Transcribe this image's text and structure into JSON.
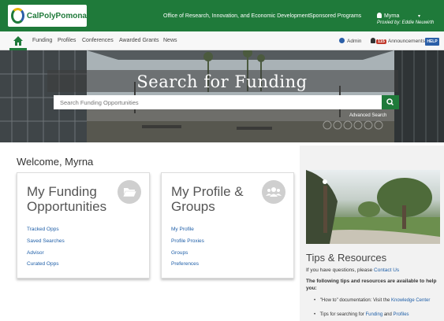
{
  "header": {
    "logo_text": "CalPolyPomona",
    "office_link": "Office of Research, Innovation, and Economic Development",
    "sponsored_link": "Sponsored Programs",
    "user_name": "Myrna",
    "proxied_by": "Proxied by: Eddie Neuwirth"
  },
  "nav": {
    "items": [
      "Funding",
      "Profiles",
      "Conferences",
      "Awarded Grants",
      "News"
    ],
    "admin": "Admin",
    "announcements_count": "115",
    "announcements": "Announcements",
    "help": "HELP"
  },
  "hero": {
    "title": "Search for Funding",
    "search_placeholder": "Search Funding Opportunities",
    "advanced_search": "Advanced Search"
  },
  "welcome": "Welcome, Myrna",
  "cards": [
    {
      "title": "My Funding Opportunities",
      "icon": "folder-open-icon",
      "links": [
        "Tracked Opps",
        "Saved Searches",
        "Advisor",
        "Curated Opps"
      ]
    },
    {
      "title": "My Profile & Groups",
      "icon": "users-icon",
      "links": [
        "My Profile",
        "Profile Proxies",
        "Groups",
        "Preferences"
      ]
    }
  ],
  "tips": {
    "title": "Tips & Resources",
    "questions_prefix": "If you have questions, please ",
    "contact_link": "Contact Us",
    "intro": "The following tips and resources are available to help you:",
    "bullet1_prefix": "\"How to\" documentation: Visit the ",
    "bullet1_link": "Knowledge Center",
    "bullet2_prefix": "Tips for searching for ",
    "bullet2_link1": "Funding",
    "bullet2_mid": " and ",
    "bullet2_link2": "Profiles"
  },
  "colors": {
    "brand_green": "#1f7a3a",
    "link_blue": "#1f5fa8"
  }
}
